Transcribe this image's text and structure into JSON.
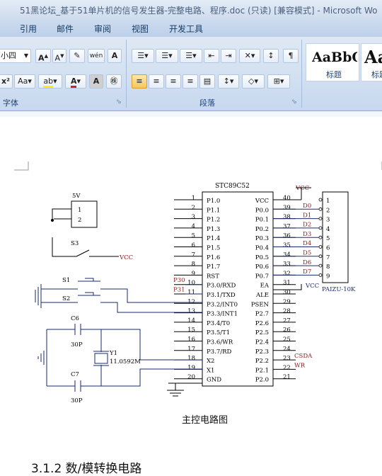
{
  "window": {
    "title": "51黑论坛_基于51单片机的信号发生器-完整电路、程序.doc (只读) [兼容模式] - Microsoft Wo"
  },
  "tabs": [
    "引用",
    "邮件",
    "审阅",
    "视图",
    "开发工具"
  ],
  "ribbon": {
    "font_group_label": "字体",
    "paragraph_group_label": "段落",
    "font_size_value": "小四",
    "style_samples": [
      {
        "sample": "AaBbC",
        "name": "标题"
      },
      {
        "sample": "Aa",
        "name": "标题"
      }
    ],
    "icons": [
      "grow-font-icon",
      "shrink-font-icon",
      "clear-format-icon",
      "phonetic-guide-icon",
      "char-border-icon",
      "subscript-icon",
      "change-case-icon",
      "highlight-icon",
      "font-color-icon",
      "char-shading-icon",
      "enclose-char-icon",
      "bullets-icon",
      "numbering-icon",
      "multilevel-list-icon",
      "decrease-indent-icon",
      "increase-indent-icon",
      "chinese-layout-icon",
      "sort-icon",
      "show-marks-icon",
      "align-left-icon",
      "center-icon",
      "align-right-icon",
      "justify-icon",
      "distributed-icon",
      "line-spacing-icon",
      "shading-icon",
      "borders-icon",
      "dialog-launcher-icon"
    ]
  },
  "document": {
    "figure_caption": "主控电路图",
    "section_heading": "3.1.2 数/模转换电路",
    "schematic": {
      "chip_label": "STC89C52",
      "left_pin_numbers": [
        "1",
        "2",
        "3",
        "4",
        "5",
        "6",
        "7",
        "8",
        "9",
        "10",
        "11",
        "12",
        "13",
        "14",
        "15",
        "16",
        "17",
        "18",
        "19",
        "20"
      ],
      "left_pin_names": [
        "P1.0",
        "P1.1",
        "P1.2",
        "P1.3",
        "P1.4",
        "P1.5",
        "P1.6",
        "P1.7",
        "RST",
        "P3.0/RXD",
        "P3.1/TXD",
        "P3.2/INT0",
        "P3.3/INT1",
        "P3.4/T0",
        "P3.5/T1",
        "P3.6/WR",
        "P3.7/RD",
        "X2",
        "X1",
        "GND"
      ],
      "right_pin_numbers": [
        "40",
        "39",
        "38",
        "37",
        "36",
        "35",
        "34",
        "33",
        "32",
        "31",
        "30",
        "29",
        "28",
        "27",
        "26",
        "25",
        "24",
        "23",
        "22",
        "21"
      ],
      "right_pin_names": [
        "VCC",
        "P0.0",
        "P0.1",
        "P0.2",
        "P0.3",
        "P0.4",
        "P0.5",
        "P0.6",
        "P0.7",
        "EA",
        "ALE",
        "PSEN",
        "P2.7",
        "P2.6",
        "P2.5",
        "P2.4",
        "P2.3",
        "P2.2",
        "P2.1",
        "P2.0"
      ],
      "net_labels_left": [
        "P30",
        "P31"
      ],
      "data_nets": [
        "D0",
        "D1",
        "D2",
        "D3",
        "D4",
        "D5",
        "D6",
        "D7"
      ],
      "right_nets": [
        "CSDA",
        "WR"
      ],
      "vcc_label": "VCC",
      "connector_label": "PAIZU-10K",
      "connector_pins": [
        "1",
        "2",
        "3",
        "4",
        "5",
        "6",
        "7",
        "8",
        "9"
      ],
      "power_label": "5V",
      "power_pins": [
        "1",
        "2"
      ],
      "switches": [
        "S3",
        "S1",
        "S2"
      ],
      "capacitors": [
        {
          "ref": "C6",
          "value": "30P"
        },
        {
          "ref": "C7",
          "value": "30P"
        }
      ],
      "crystal": {
        "ref": "Y1",
        "value": "11.0592M"
      }
    }
  }
}
